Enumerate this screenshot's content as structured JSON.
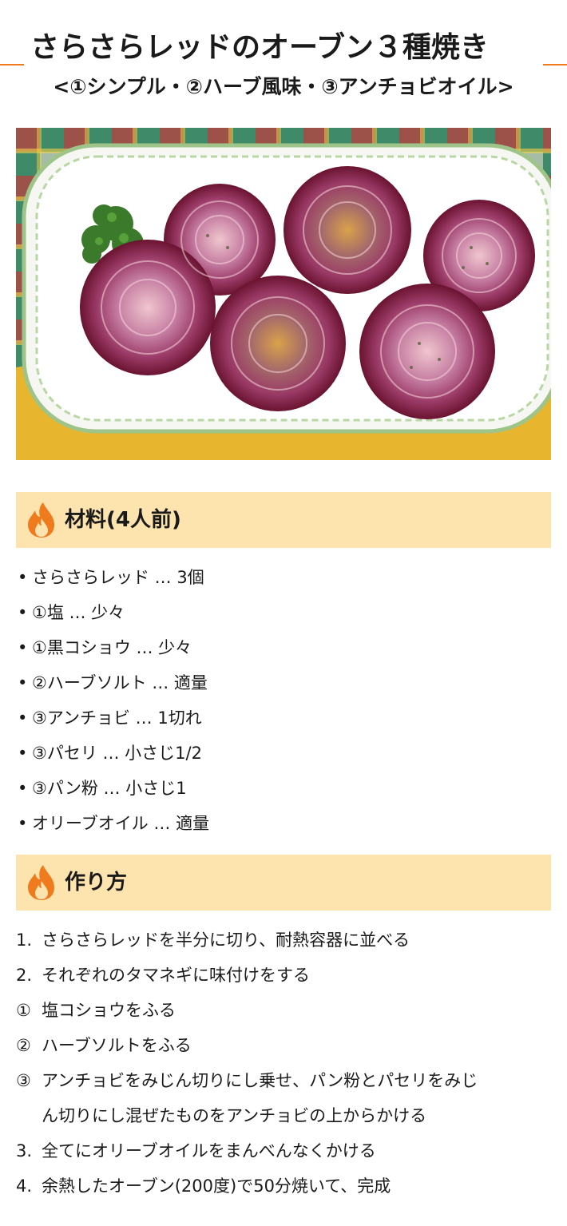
{
  "header": {
    "title": "さらさらレッドのオーブン３種焼き",
    "subtitle": "<①シンプル・②ハーブ風味・③アンチョビオイル>"
  },
  "photo": {
    "description_icon": "baked-red-onions-photo"
  },
  "ingredients_section": {
    "heading": "材料(4人前)",
    "icon": "flame-icon",
    "items": [
      "さらさらレッド … 3個",
      "①塩 … 少々",
      "①黒コショウ … 少々",
      "②ハーブソルト … 適量",
      "③アンチョビ … 1切れ",
      "③パセリ … 小さじ1/2",
      "③パン粉 … 小さじ1",
      "オリーブオイル … 適量"
    ]
  },
  "steps_section": {
    "heading": "作り方",
    "icon": "flame-icon",
    "steps": [
      {
        "num": "1.",
        "text": "さらさらレッドを半分に切り、耐熱容器に並べる"
      },
      {
        "num": "2.",
        "text": "それぞれのタマネギに味付けをする"
      },
      {
        "num": "①",
        "text": "塩コショウをふる"
      },
      {
        "num": "②",
        "text": "ハーブソルトをふる"
      },
      {
        "num": "③",
        "text": "アンチョビをみじん切りにし乗せ、パン粉とパセリをみじ"
      },
      {
        "num": "",
        "text": "ん切りにし混ぜたものをアンチョビの上からかける"
      },
      {
        "num": "3.",
        "text": "全てにオリーブオイルをまんべんなくかける"
      },
      {
        "num": "4.",
        "text": "余熱したオーブン(200度)で50分焼いて、完成"
      }
    ]
  },
  "colors": {
    "accent_orange": "#f07a1e",
    "section_bg": "#fde3ad"
  }
}
